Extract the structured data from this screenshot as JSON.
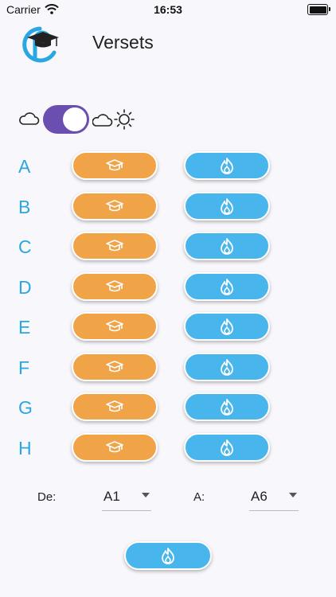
{
  "status_bar": {
    "carrier": "Carrier",
    "time": "16:53"
  },
  "header": {
    "title": "Versets"
  },
  "theme_toggle": {
    "state": "on"
  },
  "rows": [
    {
      "letter": "A"
    },
    {
      "letter": "B"
    },
    {
      "letter": "C"
    },
    {
      "letter": "D"
    },
    {
      "letter": "E"
    },
    {
      "letter": "F"
    },
    {
      "letter": "G"
    },
    {
      "letter": "H"
    }
  ],
  "range": {
    "from_label": "De:",
    "from_value": "A1",
    "to_label": "A:",
    "to_value": "A6"
  },
  "colors": {
    "accent": "#2aa7e1",
    "learn": "#f0a347",
    "practice": "#48b6ec",
    "toggle": "#6a4fb0"
  },
  "icons": {
    "learn": "graduation-cap-icon",
    "practice": "flame-icon"
  }
}
